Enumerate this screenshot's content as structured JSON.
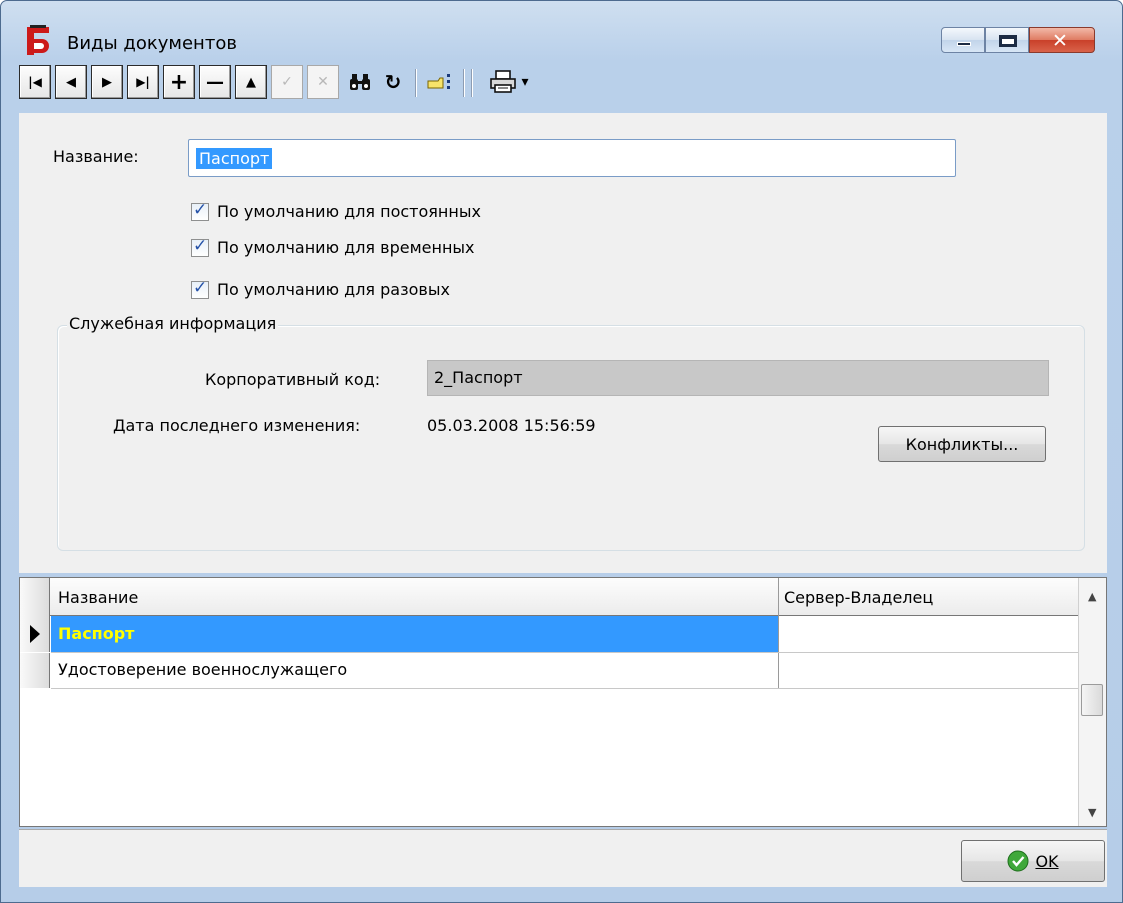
{
  "window": {
    "title": "Виды документов"
  },
  "toolbar": {
    "first": "|◀",
    "prev": "◀",
    "next": "▶",
    "last": "▶|",
    "add": "+",
    "remove": "—",
    "up": "▲",
    "post": "✓",
    "cancel": "✕",
    "find": "🔍",
    "refresh": "↻",
    "print_arrow": "▾"
  },
  "form": {
    "name_label": "Название:",
    "name_value": "Паспорт",
    "checkboxes": [
      {
        "label": "По умолчанию для постоянных",
        "checked": true
      },
      {
        "label": "По умолчанию для временных",
        "checked": true
      },
      {
        "label": "По умолчанию для разовых",
        "checked": true
      }
    ],
    "service_group": {
      "legend": "Служебная информация",
      "corp_code_label": "Корпоративный код:",
      "corp_code_value": "2_Паспорт",
      "last_modified_label": "Дата последнего изменения:",
      "last_modified_value": "05.03.2008 15:56:59",
      "conflicts_button": "Конфликты..."
    }
  },
  "grid": {
    "columns": [
      "Название",
      "Сервер-Владелец"
    ],
    "rows": [
      {
        "name": "Паспорт",
        "owner": "",
        "selected": true
      },
      {
        "name": "Удостоверение военнослужащего",
        "owner": "",
        "selected": false
      }
    ]
  },
  "footer": {
    "ok_button": "OK"
  },
  "colors": {
    "selection": "#3399ff",
    "selected_text": "#ffff00",
    "form_bg": "#f0f0f0",
    "readonly_field": "#c8c8c8"
  },
  "icons": [
    "app-logo-icon",
    "binoculars-icon",
    "refresh-icon",
    "pointer-list-icon",
    "printer-icon",
    "ok-check-icon"
  ]
}
